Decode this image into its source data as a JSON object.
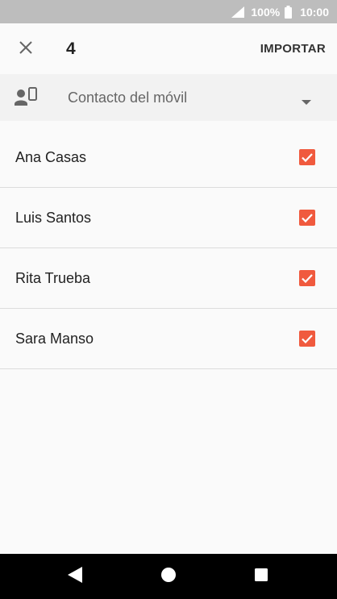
{
  "status_bar": {
    "battery_percent": "100%",
    "time": "10:00",
    "signal_icon": "signal-icon",
    "battery_icon": "battery-icon"
  },
  "app_bar": {
    "close_icon": "close-icon",
    "selected_count": "4",
    "import_label": "IMPORTAR"
  },
  "account": {
    "label": "Contacto del móvil",
    "icon": "contact-phone-icon",
    "dropdown_icon": "dropdown-arrow-icon"
  },
  "contacts": [
    {
      "name": "Ana Casas",
      "checked": true
    },
    {
      "name": "Luis Santos",
      "checked": true
    },
    {
      "name": "Rita Trueba",
      "checked": true
    },
    {
      "name": "Sara Manso",
      "checked": true
    }
  ],
  "colors": {
    "accent": "#f05a3e",
    "status_bar": "#bdbdbd",
    "nav_bar": "#000000"
  },
  "nav_bar": {
    "back_icon": "back-icon",
    "home_icon": "home-icon",
    "recents_icon": "recents-icon"
  }
}
